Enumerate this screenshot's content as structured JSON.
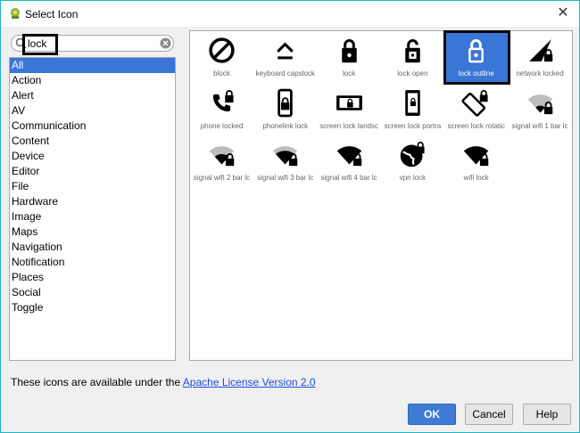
{
  "window": {
    "title": "Select Icon",
    "close_glyph": "✕"
  },
  "search": {
    "value": "lock",
    "placeholder": ""
  },
  "categories": [
    "All",
    "Action",
    "Alert",
    "AV",
    "Communication",
    "Content",
    "Device",
    "Editor",
    "File",
    "Hardware",
    "Image",
    "Maps",
    "Navigation",
    "Notification",
    "Places",
    "Social",
    "Toggle"
  ],
  "selected_category": "All",
  "icons": [
    {
      "label": "block",
      "icon": "block-icon"
    },
    {
      "label": "keyboard capslock",
      "icon": "keyboard-capslock-icon"
    },
    {
      "label": "lock",
      "icon": "lock-icon"
    },
    {
      "label": "lock open",
      "icon": "lock-open-icon"
    },
    {
      "label": "lock outline",
      "icon": "lock-outline-icon"
    },
    {
      "label": "network locked",
      "icon": "network-locked-icon"
    },
    {
      "label": "phone locked",
      "icon": "phone-locked-icon"
    },
    {
      "label": "phonelink lock",
      "icon": "phonelink-lock-icon"
    },
    {
      "label": "screen lock landsc",
      "icon": "screen-lock-landscape-icon"
    },
    {
      "label": "screen lock portra",
      "icon": "screen-lock-portrait-icon"
    },
    {
      "label": "screen lock rotatic",
      "icon": "screen-lock-rotation-icon"
    },
    {
      "label": "signal wifi 1 bar lc",
      "icon": "signal-wifi-1-bar-lock-icon"
    },
    {
      "label": "signal wifi 2 bar lc",
      "icon": "signal-wifi-2-bar-lock-icon"
    },
    {
      "label": "signal wifi 3 bar lc",
      "icon": "signal-wifi-3-bar-lock-icon"
    },
    {
      "label": "signal wifi 4 bar lc",
      "icon": "signal-wifi-4-bar-lock-icon"
    },
    {
      "label": "vpn lock",
      "icon": "vpn-lock-icon"
    },
    {
      "label": "wifi lock",
      "icon": "wifi-lock-icon"
    }
  ],
  "selected_icon": "lock outline",
  "footer": {
    "license_text": "These icons are available under the",
    "license_link": "Apache License Version 2.0"
  },
  "buttons": {
    "ok": "OK",
    "cancel": "Cancel",
    "help": "Help"
  },
  "colors": {
    "accent": "#3a76d6",
    "frame_border": "#1fb6c5",
    "link": "#1d4fd9"
  }
}
